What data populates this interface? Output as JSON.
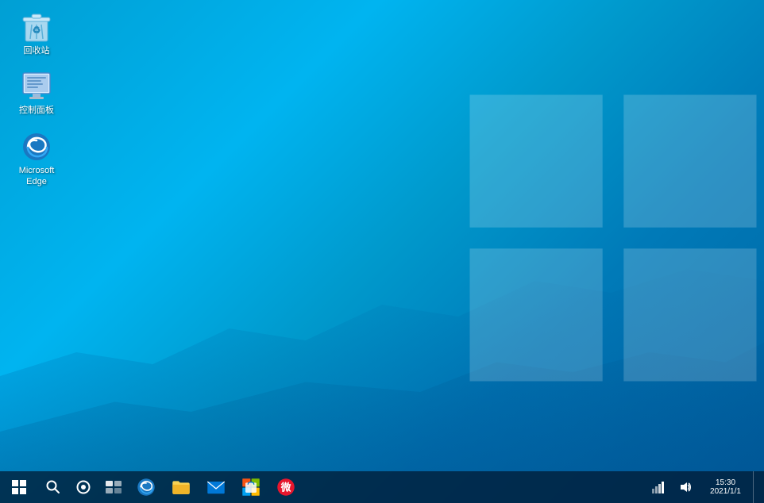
{
  "desktop": {
    "background_color": "#009fd4"
  },
  "desktop_icons": [
    {
      "id": "recycle-bin",
      "label": "回收站",
      "icon_type": "recycle-bin"
    },
    {
      "id": "control-panel",
      "label": "控制面板",
      "icon_type": "control-panel"
    },
    {
      "id": "microsoft-edge",
      "label": "Microsoft Edge",
      "icon_type": "edge"
    }
  ],
  "taskbar": {
    "start_label": "开始",
    "search_label": "搜索",
    "cortana_label": "Cortana",
    "taskview_label": "任务视图",
    "pinned_apps": [
      {
        "id": "edge",
        "label": "Microsoft Edge",
        "icon_type": "edge"
      },
      {
        "id": "file-explorer",
        "label": "文件资源管理器",
        "icon_type": "folder"
      },
      {
        "id": "mail",
        "label": "邮件",
        "icon_type": "mail"
      },
      {
        "id": "store",
        "label": "Microsoft Store",
        "icon_type": "store"
      },
      {
        "id": "weibo",
        "label": "微博",
        "icon_type": "weibo"
      }
    ],
    "tray": {
      "time": "15:30",
      "date": "2021/1/1",
      "show_desktop_label": "显示桌面"
    }
  }
}
